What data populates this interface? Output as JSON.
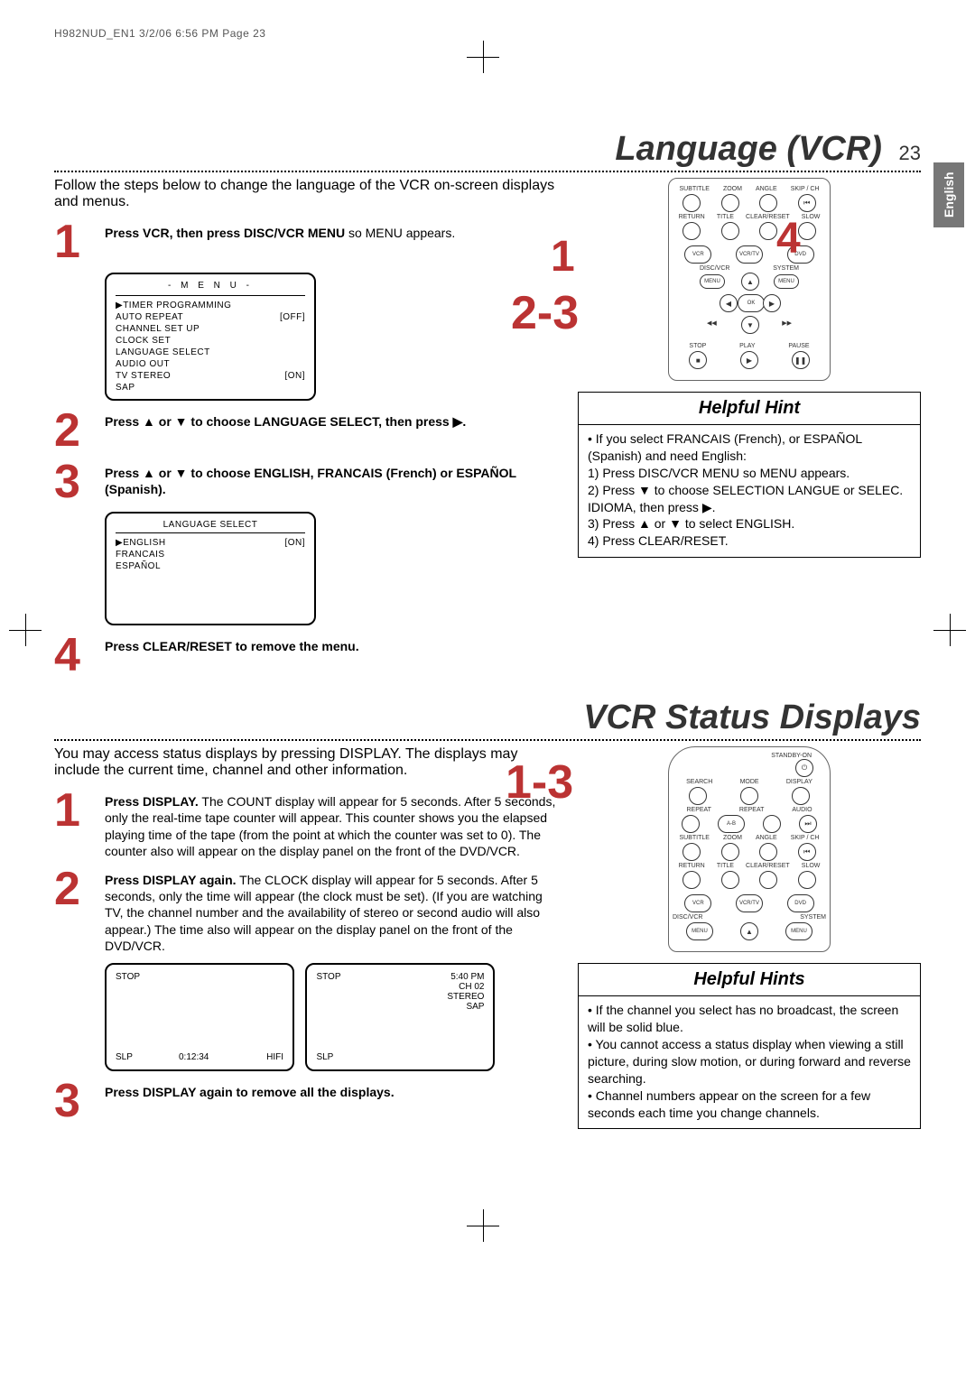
{
  "print_header": "H982NUD_EN1  3/2/06  6:56 PM  Page 23",
  "side_tab": "English",
  "section1": {
    "title": "Language (VCR)",
    "page_number": "23",
    "intro": "Follow the steps below to change the language of the VCR on-screen displays and menus.",
    "step1": {
      "num": "1",
      "bold": "Press VCR, then press DISC/VCR MENU",
      "rest": " so MENU appears."
    },
    "menu": {
      "title": "- M E N U -",
      "items": [
        {
          "label": "▶TIMER PROGRAMMING",
          "val": ""
        },
        {
          "label": "  AUTO REPEAT",
          "val": "[OFF]"
        },
        {
          "label": "  CHANNEL SET UP",
          "val": ""
        },
        {
          "label": "  CLOCK SET",
          "val": ""
        },
        {
          "label": "  LANGUAGE SELECT",
          "val": ""
        },
        {
          "label": "  AUDIO OUT",
          "val": ""
        },
        {
          "label": "  TV STEREO",
          "val": "[ON]"
        },
        {
          "label": "  SAP",
          "val": ""
        }
      ]
    },
    "step2": {
      "num": "2",
      "bold": "Press ▲ or ▼ to choose LANGUAGE SELECT, then press ▶."
    },
    "step3": {
      "num": "3",
      "bold": "Press ▲ or ▼ to choose ENGLISH, FRANCAIS (French) or ESPAÑOL (Spanish)."
    },
    "lang_menu": {
      "title": "LANGUAGE SELECT",
      "items": [
        {
          "label": "▶ENGLISH",
          "val": "[ON]"
        },
        {
          "label": "  FRANCAIS",
          "val": ""
        },
        {
          "label": "  ESPAÑOL",
          "val": ""
        }
      ]
    },
    "step4": {
      "num": "4",
      "bold": "Press CLEAR/RESET to remove the menu."
    },
    "callouts": {
      "c1": "1",
      "c23": "2-3",
      "c4": "4"
    },
    "hint": {
      "title": "Helpful Hint",
      "lines": [
        "• If you select FRANCAIS (French), or ESPAÑOL (Spanish) and need English:",
        "1) Press DISC/VCR MENU so MENU appears.",
        "2) Press ▼ to choose SELECTION LANGUE or SELEC. IDIOMA, then press ▶.",
        "3) Press ▲ or ▼ to select ENGLISH.",
        "4) Press CLEAR/RESET."
      ]
    },
    "remote": {
      "row1": [
        "SUBTITLE",
        "ZOOM",
        "ANGLE",
        "SKIP / CH"
      ],
      "row2": [
        "RETURN",
        "TITLE",
        "CLEAR/RESET",
        "SLOW"
      ],
      "ovals": [
        "VCR",
        "VCR/TV",
        "DVD"
      ],
      "dv": "DISC/VCR",
      "sys": "SYSTEM",
      "menu": "MENU",
      "ok": "OK",
      "bottom": [
        "STOP",
        "PLAY",
        "PAUSE"
      ]
    }
  },
  "section2": {
    "title": "VCR Status Displays",
    "intro": "You may access status displays by pressing DISPLAY. The displays may include the current time, channel and other information.",
    "step1": {
      "num": "1",
      "bold": "Press DISPLAY.",
      "rest": " The COUNT display will appear for 5 seconds. After 5 seconds, only the real-time tape counter will appear. This counter shows you the elapsed playing time of the tape (from the point at which the counter was set to 0). The counter also will appear on the display panel on the front of the DVD/VCR."
    },
    "step2": {
      "num": "2",
      "bold": "Press DISPLAY again.",
      "rest": " The CLOCK display will appear for 5 seconds. After 5 seconds, only the time will appear (the clock must be set). (If you are watching TV, the channel number and the availability of stereo or second audio will also appear.) The time also will appear on the display panel on the front of the DVD/VCR."
    },
    "status_a": {
      "tl": "STOP",
      "bl": "SLP",
      "bc": "0:12:34",
      "br": "HIFI"
    },
    "status_b": {
      "tl": "STOP",
      "tr": "5:40 PM\nCH 02\nSTEREO\nSAP",
      "bl": "SLP"
    },
    "step3": {
      "num": "3",
      "bold": "Press DISPLAY again to remove all the displays."
    },
    "callout": "1-3",
    "remote": {
      "standby": "STANDBY-ON",
      "row1": [
        "SEARCH",
        "MODE",
        "DISPLAY"
      ],
      "row2": [
        "REPEAT",
        "REPEAT",
        "AUDIO"
      ],
      "ab": "A-B",
      "row3": [
        "SUBTITLE",
        "ZOOM",
        "ANGLE",
        "SKIP / CH"
      ],
      "row4": [
        "RETURN",
        "TITLE",
        "CLEAR/RESET",
        "SLOW"
      ],
      "ovals": [
        "VCR",
        "VCR/TV",
        "DVD"
      ],
      "dv": "DISC/VCR",
      "sys": "SYSTEM",
      "menu": "MENU"
    },
    "hints": {
      "title": "Helpful Hints",
      "lines": [
        "• If the channel you select has no broadcast, the screen will be solid blue.",
        "• You cannot access a status display when viewing a still picture, during slow motion, or during forward and reverse searching.",
        "• Channel numbers appear on the screen for a few seconds each time you change channels."
      ]
    }
  }
}
